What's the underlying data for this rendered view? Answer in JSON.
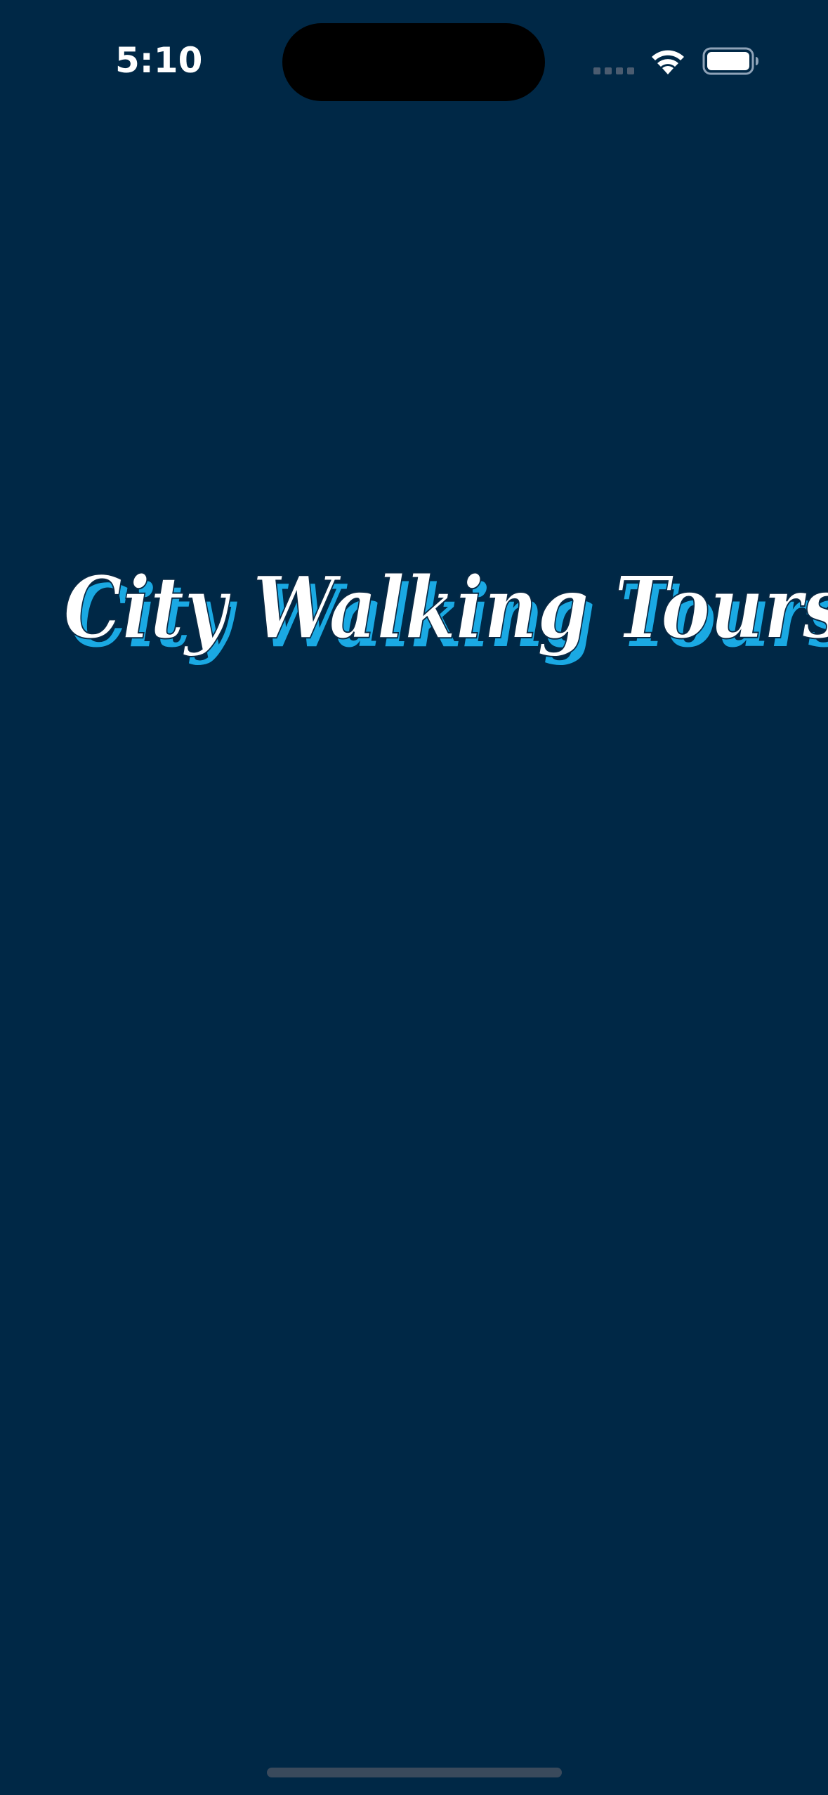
{
  "status_bar": {
    "time": "5:10",
    "icons": [
      "cellular-signal-icon",
      "wifi-icon",
      "battery-icon"
    ]
  },
  "splash": {
    "title": "City Walking Tours"
  },
  "colors": {
    "background": "#002846",
    "title_text": "#ffffff",
    "title_shadow": "#1aa9e3"
  }
}
